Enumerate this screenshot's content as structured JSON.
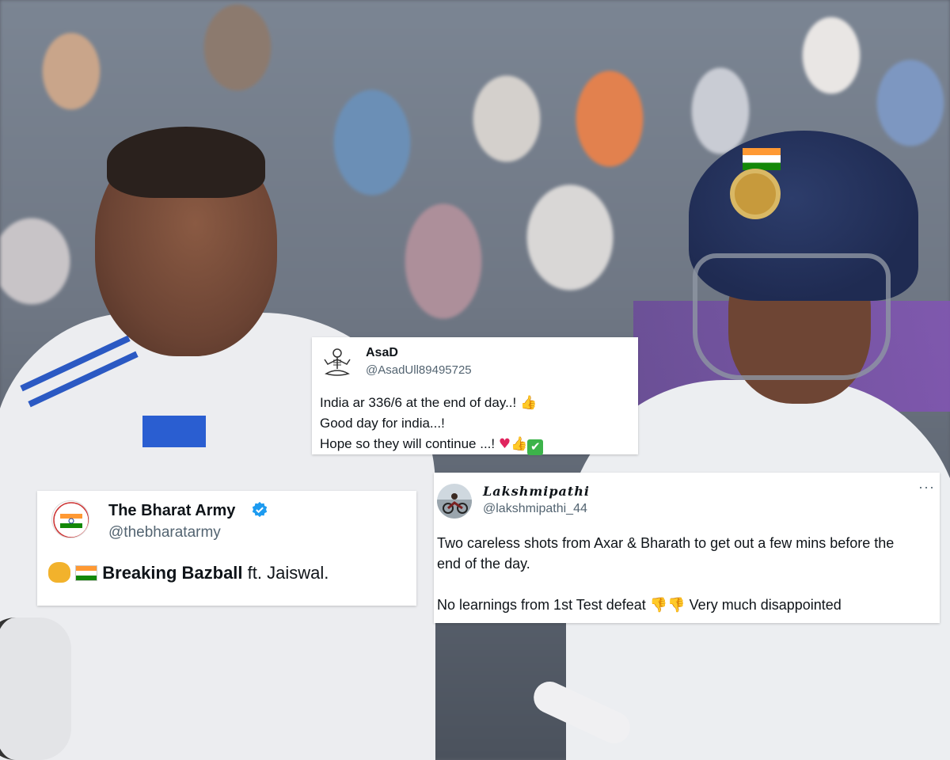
{
  "tweets": [
    {
      "id": "asad",
      "name": "AsaD",
      "handle": "@AsadUll89495725",
      "lines": [
        "India ar 336/6 at the end of day..!",
        "Good day for india...!",
        "Hope so they will continue ...!"
      ],
      "avatar_icon": "meditating-skeleton-icon"
    },
    {
      "id": "bharat-army",
      "name": "The Bharat Army",
      "handle": "@thebharatarmy",
      "verified": true,
      "body_bold": "Breaking Bazball",
      "body_rest": " ft. Jaiswal.",
      "avatar_icon": "bharat-army-logo-icon"
    },
    {
      "id": "lakshmipathi",
      "name": "Lakshmipathi",
      "handle": "@lakshmipathi_44",
      "more_label": "···",
      "lines": [
        "Two careless shots from Axar & Bharath to get out a few mins before the",
        "end of the day.",
        "",
        "No learnings from 1st Test defeat",
        "Very much disappointed"
      ],
      "avatar_icon": "motorcycle-photo-icon"
    }
  ],
  "colors": {
    "handle": "#536471",
    "text": "#0f1419",
    "verified": "#1d9bf0"
  }
}
